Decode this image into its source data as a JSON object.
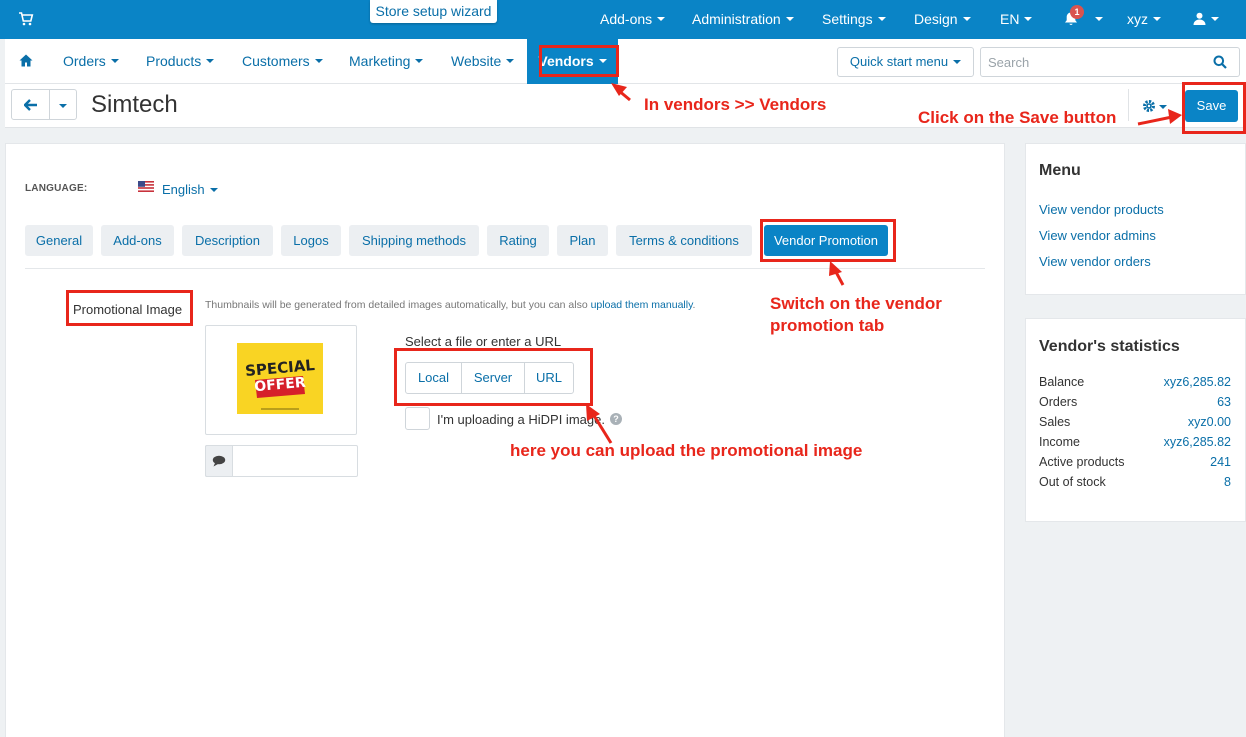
{
  "topbar": {
    "wizard_label": "Store setup wizard",
    "menus": [
      "Add-ons",
      "Administration",
      "Settings",
      "Design",
      "EN"
    ],
    "notifications": "1",
    "user": "xyz"
  },
  "nav": {
    "items": [
      "Orders",
      "Products",
      "Customers",
      "Marketing",
      "Website",
      "Vendors"
    ],
    "quick_start": "Quick start menu",
    "search_placeholder": "Search"
  },
  "header": {
    "title": "Simtech",
    "save": "Save"
  },
  "form": {
    "language_label": "LANGUAGE:",
    "language_value": "English",
    "tabs": [
      "General",
      "Add-ons",
      "Description",
      "Logos",
      "Shipping methods",
      "Rating",
      "Plan",
      "Terms & conditions",
      "Vendor Promotion"
    ],
    "promo_label": "Promotional Image",
    "hint_text": "Thumbnails will be generated from detailed images automatically, but you can also ",
    "hint_link": "upload them manually",
    "hint_end": ".",
    "offer_line1": "SPECIAL",
    "offer_line2": "OFFER",
    "select_label": "Select a file or enter a URL",
    "upload_buttons": [
      "Local",
      "Server",
      "URL"
    ],
    "hidpi_label": "I'm uploading a HiDPI image."
  },
  "sidebar": {
    "menu_title": "Menu",
    "links": [
      "View vendor products",
      "View vendor admins",
      "View vendor orders"
    ],
    "stats_title": "Vendor's statistics",
    "stats": [
      {
        "label": "Balance",
        "value": "xyz6,285.82"
      },
      {
        "label": "Orders",
        "value": "63"
      },
      {
        "label": "Sales",
        "value": "xyz0.00"
      },
      {
        "label": "Income",
        "value": "xyz6,285.82"
      },
      {
        "label": "Active products",
        "value": "241"
      },
      {
        "label": "Out of stock",
        "value": "8"
      }
    ]
  },
  "annotations": {
    "vendors_note": "In vendors >> Vendors",
    "save_note": "Click on the Save button",
    "tab_note_1": "Switch on the vendor",
    "tab_note_2": "promotion tab",
    "upload_note": "here you can upload the promotional image"
  },
  "colors": {
    "topbar": "#0a84c6",
    "link": "#0a6fa8",
    "annotation": "#e8261b"
  }
}
